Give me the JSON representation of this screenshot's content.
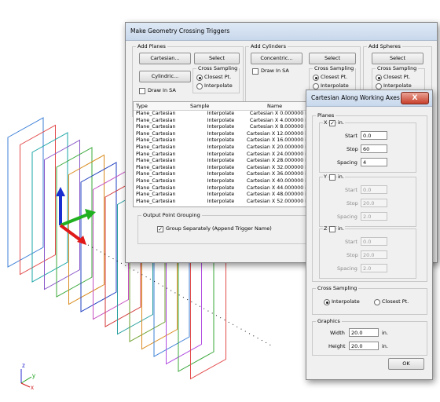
{
  "main_dialog": {
    "title": "Make Geometry Crossing Triggers",
    "add_planes": {
      "label": "Add Planes",
      "cartesian_btn": "Cartesian...",
      "select_btn": "Select",
      "cylindric_btn": "Cylindric...",
      "cross_sampling_label": "Cross Sampling",
      "closest_pt": "Closest Pt.",
      "interpolate": "Interpolate",
      "draw_in_sa": "Draw In SA"
    },
    "add_cylinders": {
      "label": "Add Cylinders",
      "concentric_btn": "Concentric...",
      "select_btn": "Select",
      "draw_in_sa": "Draw In SA",
      "cross_sampling_label": "Cross Sampling",
      "closest_pt": "Closest Pt.",
      "interpolate": "Interpolate"
    },
    "add_spheres": {
      "label": "Add Spheres",
      "select_btn": "Select",
      "cross_sampling_label": "Cross Sampling",
      "closest_pt": "Closest Pt.",
      "interpolate": "Interpolate"
    },
    "table": {
      "headers": [
        "Type",
        "Sample",
        "Name"
      ],
      "rows": [
        [
          "Plane_Cartesian",
          "Interpolate",
          "Cartesian X 0.000000 in."
        ],
        [
          "Plane_Cartesian",
          "Interpolate",
          "Cartesian X 4.000000 in."
        ],
        [
          "Plane_Cartesian",
          "Interpolate",
          "Cartesian X 8.000000 in."
        ],
        [
          "Plane_Cartesian",
          "Interpolate",
          "Cartesian X 12.000000 in."
        ],
        [
          "Plane_Cartesian",
          "Interpolate",
          "Cartesian X 16.000000 in."
        ],
        [
          "Plane_Cartesian",
          "Interpolate",
          "Cartesian X 20.000000 in."
        ],
        [
          "Plane_Cartesian",
          "Interpolate",
          "Cartesian X 24.000000 in."
        ],
        [
          "Plane_Cartesian",
          "Interpolate",
          "Cartesian X 28.000000 in."
        ],
        [
          "Plane_Cartesian",
          "Interpolate",
          "Cartesian X 32.000000 in."
        ],
        [
          "Plane_Cartesian",
          "Interpolate",
          "Cartesian X 36.000000 in."
        ],
        [
          "Plane_Cartesian",
          "Interpolate",
          "Cartesian X 40.000000 in."
        ],
        [
          "Plane_Cartesian",
          "Interpolate",
          "Cartesian X 44.000000 in."
        ],
        [
          "Plane_Cartesian",
          "Interpolate",
          "Cartesian X 48.000000 in."
        ],
        [
          "Plane_Cartesian",
          "Interpolate",
          "Cartesian X 52.000000 in."
        ]
      ]
    },
    "output_grouping": {
      "label": "Output Point Grouping",
      "group_separately": "Group Separately (Append Trigger Name)"
    }
  },
  "axes_dialog": {
    "title": "Cartesian Along Working Axes",
    "close_symbol": "X",
    "planes_label": "Planes",
    "x": {
      "axis": "X",
      "unit": "in.",
      "start_label": "Start",
      "start": "0.0",
      "stop_label": "Stop",
      "stop": "60",
      "spacing_label": "Spacing",
      "spacing": "4"
    },
    "y": {
      "axis": "Y",
      "unit": "in.",
      "start_label": "Start",
      "start": "0.0",
      "stop_label": "Stop",
      "stop": "20.0",
      "spacing_label": "Spacing",
      "spacing": "2.0"
    },
    "z": {
      "axis": "Z",
      "unit": "in.",
      "start_label": "Start",
      "start": "0.0",
      "stop_label": "Stop",
      "stop": "20.0",
      "spacing_label": "Spacing",
      "spacing": "2.0"
    },
    "cross_sampling": {
      "label": "Cross Sampling",
      "interpolate": "Interpolate",
      "closest_pt": "Closest Pt."
    },
    "graphics": {
      "label": "Graphics",
      "width_label": "Width",
      "width": "20.0",
      "width_unit": "in.",
      "height_label": "Height",
      "height": "20.0",
      "height_unit": "in."
    },
    "ok": "OK"
  },
  "axis_triad": {
    "x": "x",
    "y": "y",
    "z": "z"
  },
  "colors": {
    "plane_colors": [
      "#3d7fd6",
      "#e34a4a",
      "#1aa5a5",
      "#8a57c9",
      "#3aa83a",
      "#d98a1d",
      "#1f3fc0",
      "#c44fc0",
      "#d13535",
      "#2ba0a0",
      "#6c9f2a",
      "#d98a1d",
      "#3d7fd6",
      "#b04be0",
      "#3aa83a",
      "#e34a4a"
    ]
  }
}
